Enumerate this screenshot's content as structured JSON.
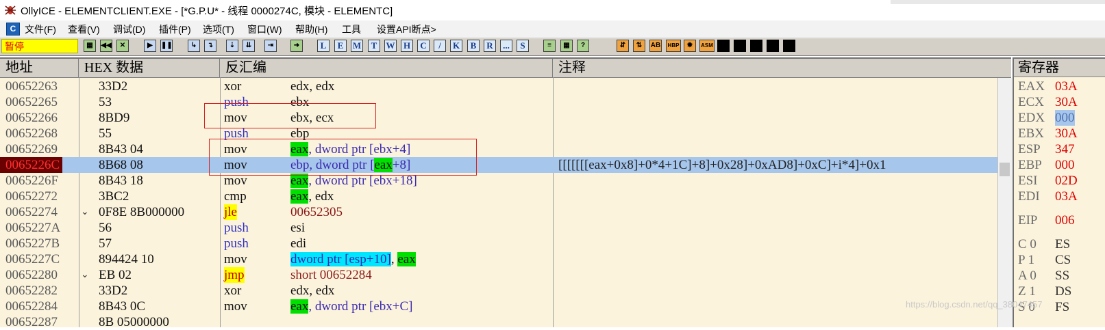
{
  "window": {
    "title": "OllyICE - ELEMENTCLIENT.EXE - [*G.P.U* -  线程 0000274C, 模块 - ELEMENTC]"
  },
  "menu": {
    "items": [
      "文件(F)",
      "查看(V)",
      "调试(D)",
      "插件(P)",
      "选项(T)",
      "窗口(W)",
      "帮助(H)",
      "工具",
      "设置API断点>"
    ]
  },
  "toolbar": {
    "status": "暂停",
    "letter_buttons": [
      "L",
      "E",
      "M",
      "T",
      "W",
      "H",
      "C",
      "/",
      "K",
      "B",
      "R",
      "...",
      "S"
    ],
    "hbp_label": "HBP",
    "asm_label": "ASM"
  },
  "disasm": {
    "headers": {
      "address": "地址",
      "hex": "HEX 数据",
      "disasm": "反汇编",
      "comment": "注释"
    },
    "rows": [
      {
        "addr": "00652263",
        "hex": "33D2",
        "mnem": "xor",
        "ops": "edx, edx"
      },
      {
        "addr": "00652265",
        "hex": "53",
        "mnem": "push",
        "ops": "ebx"
      },
      {
        "addr": "00652266",
        "hex": "8BD9",
        "mnem": "mov",
        "ops": "ebx, ecx"
      },
      {
        "addr": "00652268",
        "hex": "55",
        "mnem": "push",
        "ops": "ebp"
      },
      {
        "addr": "00652269",
        "hex": "8B43 04",
        "mnem": "mov",
        "ops_a": "eax",
        "ops_b": ", dword ptr [ebx+4]"
      },
      {
        "addr": "0065226C",
        "hex": "8B68 08",
        "mnem": "mov",
        "ops_a": "ebp, dword ptr [",
        "ops_b": "eax",
        "ops_c": "+8]",
        "comment": "[[[[[[[eax+0x8]+0*4+1C]+8]+0x28]+0xAD8]+0xC]+i*4]+0x1"
      },
      {
        "addr": "0065226F",
        "hex": "8B43 18",
        "mnem": "mov",
        "ops_a": "eax",
        "ops_b": ", dword ptr [ebx+18]"
      },
      {
        "addr": "00652272",
        "hex": "3BC2",
        "mnem": "cmp",
        "ops_a": "eax",
        "ops_b": ", edx"
      },
      {
        "addr": "00652274",
        "mark": "⌄",
        "hex": "0F8E 8B000000",
        "mnem": "jle",
        "ops": "00652305"
      },
      {
        "addr": "0065227A",
        "hex": "56",
        "mnem": "push",
        "ops": "esi"
      },
      {
        "addr": "0065227B",
        "hex": "57",
        "mnem": "push",
        "ops": "edi"
      },
      {
        "addr": "0065227C",
        "hex": "894424 10",
        "mnem": "mov",
        "ops_a": "dword ptr [esp+10]",
        "ops_b": ", ",
        "ops_c": "eax"
      },
      {
        "addr": "00652280",
        "mark": "⌄",
        "hex": "EB 02",
        "mnem": "jmp",
        "ops_a": "short ",
        "ops_b": "00652284"
      },
      {
        "addr": "00652282",
        "hex": "33D2",
        "mnem": "xor",
        "ops": "edx, edx"
      },
      {
        "addr": "00652284",
        "hex": "8B43 0C",
        "mnem": "mov",
        "ops_a": "eax",
        "ops_b": ", dword ptr [ebx+C]"
      },
      {
        "addr": "00652287",
        "hex": "8B 05000000",
        "mnem": "",
        "ops": ""
      }
    ]
  },
  "registers": {
    "header": "寄存器",
    "items": [
      {
        "name": "EAX",
        "value": "03A"
      },
      {
        "name": "ECX",
        "value": "30A"
      },
      {
        "name": "EDX",
        "value": "000"
      },
      {
        "name": "EBX",
        "value": "30A"
      },
      {
        "name": "ESP",
        "value": "347"
      },
      {
        "name": "EBP",
        "value": "000"
      },
      {
        "name": "ESI",
        "value": "02D"
      },
      {
        "name": "EDI",
        "value": "03A"
      },
      {
        "name": "EIP",
        "value": "006"
      },
      {
        "name": "C 0",
        "value": "ES"
      },
      {
        "name": "P 1",
        "value": "CS"
      },
      {
        "name": "A 0",
        "value": "SS"
      },
      {
        "name": "Z 1",
        "value": "DS"
      },
      {
        "name": "S 0",
        "value": "FS"
      }
    ]
  },
  "watermark": "https://blog.csdn.net/qq_38047457"
}
